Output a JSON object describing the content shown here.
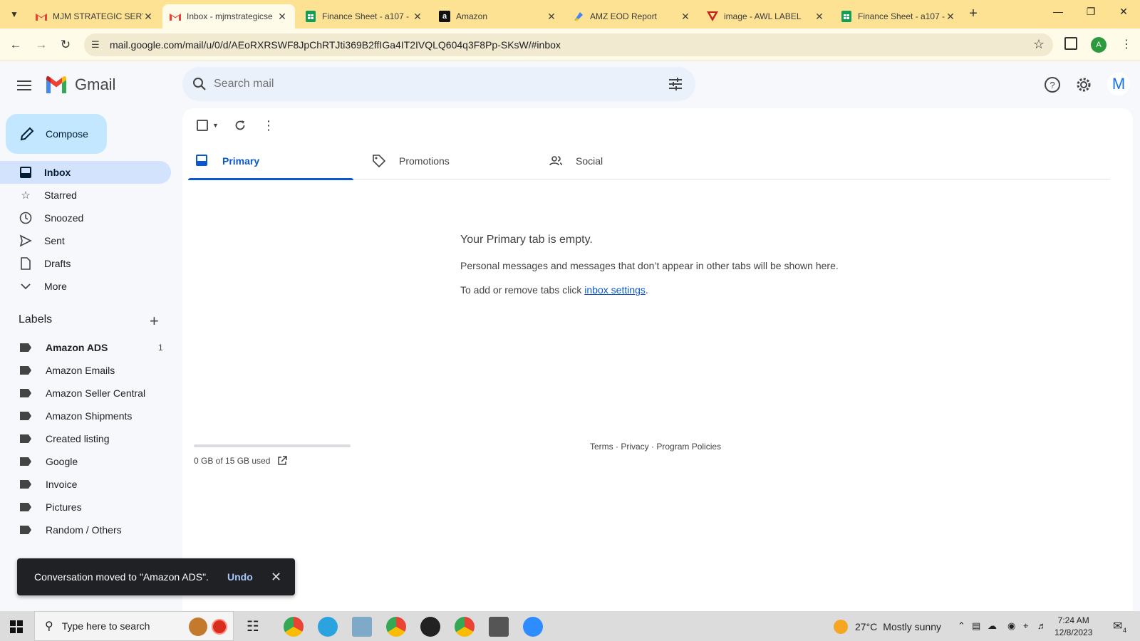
{
  "browser": {
    "tabs": [
      {
        "title": "MJM STRATEGIC SERV",
        "favicon": "gmail-favicon"
      },
      {
        "title": "Inbox - mjmstrategicse",
        "favicon": "gmail-favicon"
      },
      {
        "title": "Finance Sheet - a107 -",
        "favicon": "sheets-favicon"
      },
      {
        "title": "Amazon",
        "favicon": "amazon-favicon"
      },
      {
        "title": "AMZ EOD Report",
        "favicon": "eod-favicon"
      },
      {
        "title": "image - AWL LABEL",
        "favicon": "drive-favicon"
      },
      {
        "title": "Finance Sheet - a107 -",
        "favicon": "sheets-favicon"
      }
    ],
    "url": "mail.google.com/mail/u/0/d/AEoRXRSWF8JpChRTJti369B2ffIGa4IT2IVQLQ604q3F8Pp-SKsW/#inbox",
    "profile_initial": "A"
  },
  "gmail": {
    "logo_text": "Gmail",
    "search_placeholder": "Search mail",
    "avatar_letter": "M",
    "compose_label": "Compose",
    "nav": [
      {
        "label": "Inbox",
        "icon": "inbox-icon"
      },
      {
        "label": "Starred",
        "icon": "star-icon"
      },
      {
        "label": "Snoozed",
        "icon": "clock-icon"
      },
      {
        "label": "Sent",
        "icon": "send-icon"
      },
      {
        "label": "Drafts",
        "icon": "draft-icon"
      },
      {
        "label": "More",
        "icon": "chevron-down-icon"
      }
    ],
    "labels_heading": "Labels",
    "labels": [
      {
        "name": "Amazon ADS",
        "count": "1"
      },
      {
        "name": "Amazon Emails"
      },
      {
        "name": "Amazon Seller Central"
      },
      {
        "name": "Amazon Shipments"
      },
      {
        "name": "Created listing"
      },
      {
        "name": "Google"
      },
      {
        "name": "Invoice"
      },
      {
        "name": "Pictures"
      },
      {
        "name": "Random / Others"
      }
    ],
    "tabs": [
      {
        "label": "Primary"
      },
      {
        "label": "Promotions"
      },
      {
        "label": "Social"
      }
    ],
    "empty": {
      "heading": "Your Primary tab is empty.",
      "line1": "Personal messages and messages that don’t appear in other tabs will be shown here.",
      "line2_prefix": "To add or remove tabs click ",
      "line2_link": "inbox settings",
      "line2_suffix": "."
    },
    "storage": {
      "text": "0 GB of 15 GB used",
      "fraction": 0.0
    },
    "footer": {
      "terms": "Terms",
      "privacy": "Privacy",
      "policies": "Program Policies",
      "sep": " · "
    },
    "toast": {
      "message": "Conversation moved to \"Amazon ADS\".",
      "action": "Undo"
    }
  },
  "taskbar": {
    "search_placeholder": "Type here to search",
    "temperature": "27°C",
    "weather": "Mostly sunny",
    "time": "7:24 AM",
    "date": "12/8/2023",
    "notif_count": "4"
  },
  "colors": {
    "accent": "#0b57d0",
    "compose_bg": "#c2e7ff",
    "active_nav": "#d3e3fd",
    "chrome_bar": "#fde293"
  }
}
